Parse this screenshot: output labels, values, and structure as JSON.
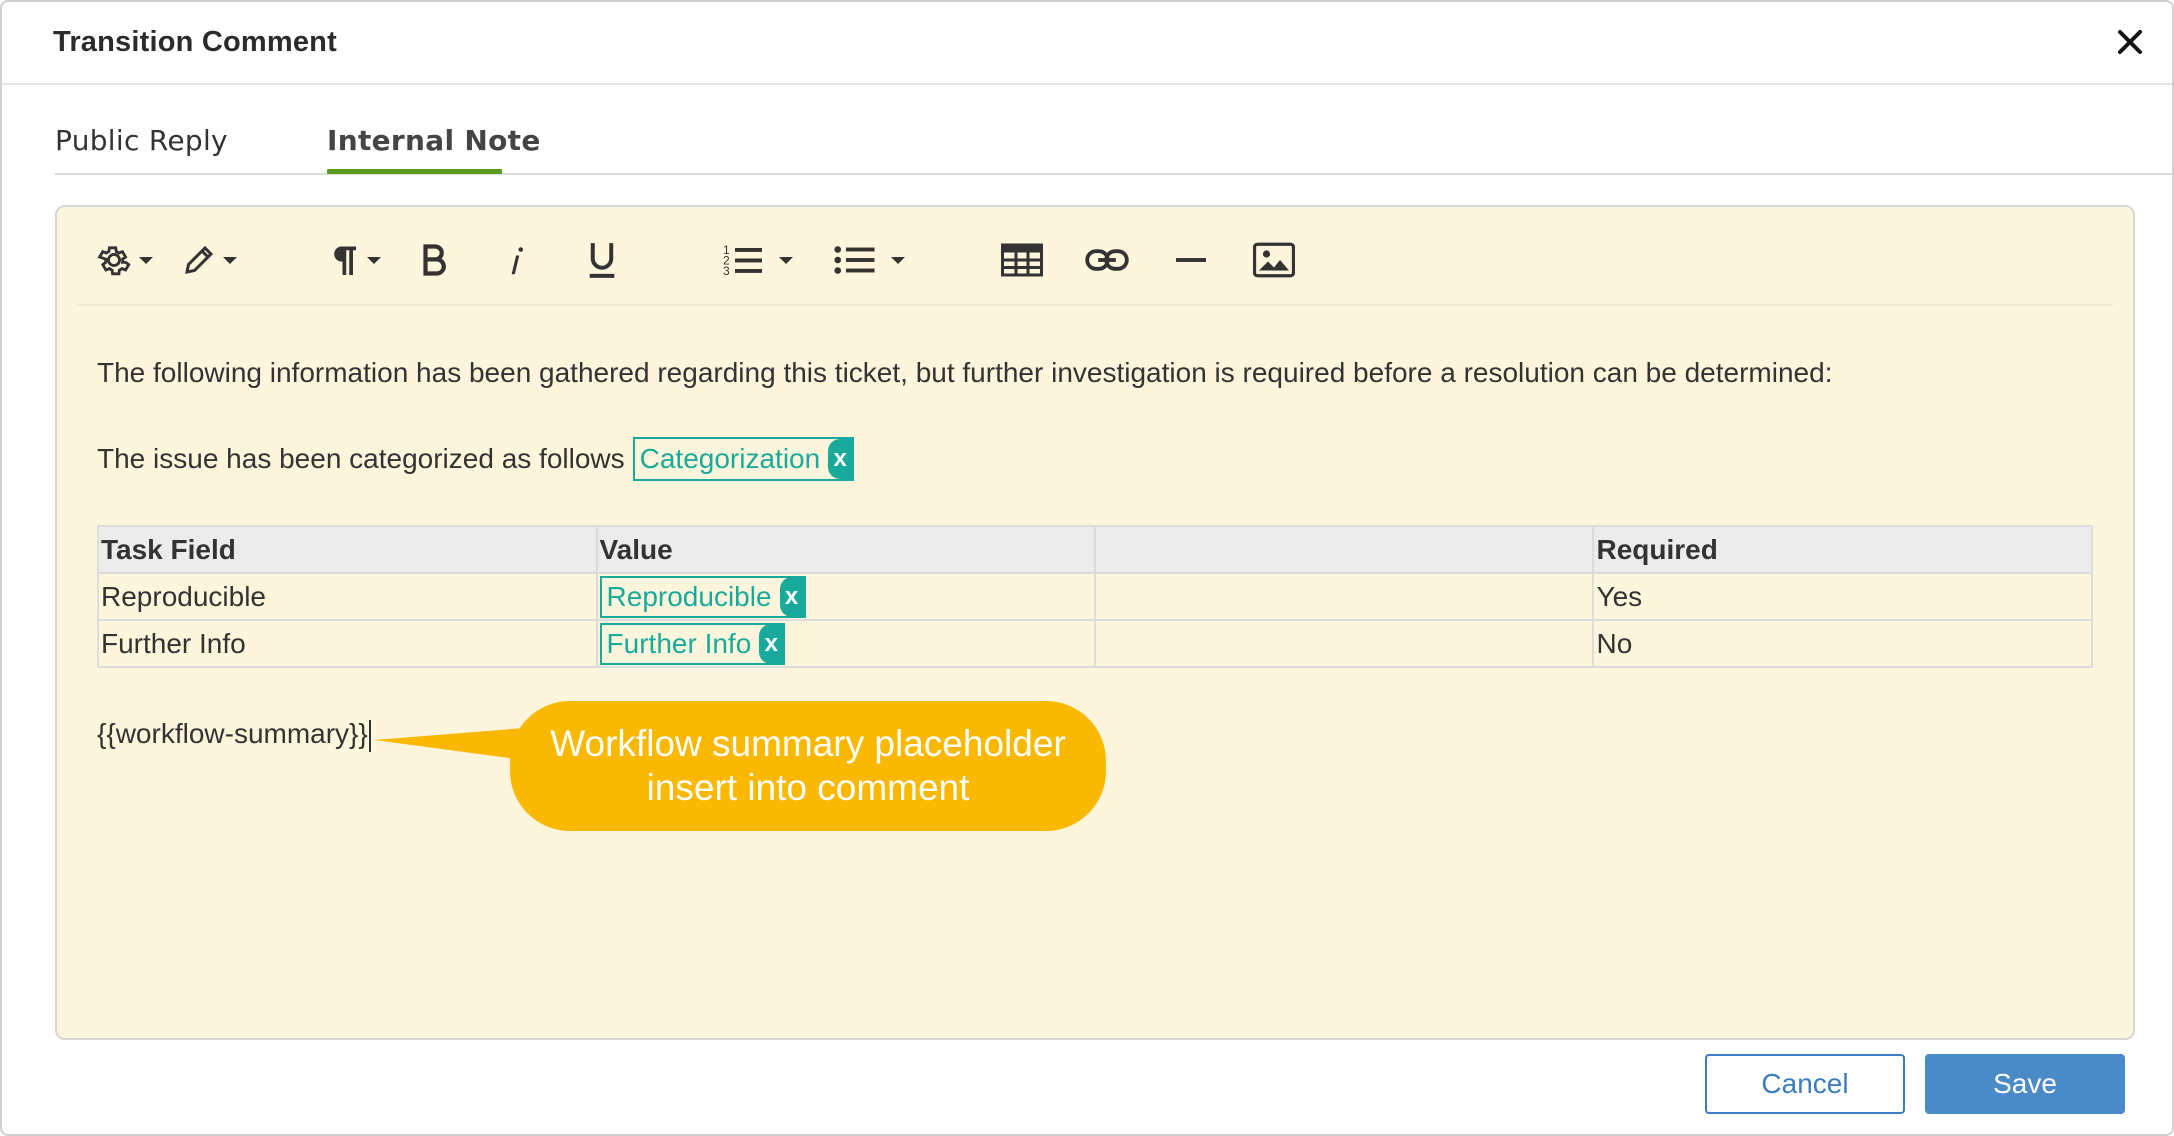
{
  "dialog": {
    "title": "Transition Comment",
    "close_icon": "close-icon"
  },
  "tabs": [
    {
      "label": "Public Reply",
      "active": false
    },
    {
      "label": "Internal Note",
      "active": true
    }
  ],
  "toolbar": {
    "items": [
      "gear-icon",
      "pencil-icon",
      "paragraph-icon",
      "bold-icon",
      "italic-icon",
      "underline-icon",
      "numbered-list-icon",
      "bullet-list-icon",
      "table-icon",
      "link-icon",
      "horizontal-rule-icon",
      "image-icon"
    ]
  },
  "editor": {
    "intro": "The following information has been gathered regarding this ticket, but further investigation is required before a resolution can be determined:",
    "category_prefix": "The issue has been categorized as follows",
    "category_token": "Categorization",
    "token_remove": "x",
    "table": {
      "headers": [
        "Task Field",
        "Value",
        "",
        "Required"
      ],
      "rows": [
        {
          "field": "Reproducible",
          "token": "Reproducible",
          "required": "Yes"
        },
        {
          "field": "Further Info",
          "token": "Further Info",
          "required": "No"
        }
      ]
    },
    "placeholder": "{{workflow-summary}}"
  },
  "callout": {
    "line1": "Workflow summary placeholder",
    "line2": "insert into comment",
    "color": "#fbb800"
  },
  "footer": {
    "cancel_label": "Cancel",
    "save_label": "Save"
  },
  "colors": {
    "accent_tab": "#5a9a1e",
    "token": "#1aaa9c",
    "editor_bg": "#fdf5dc",
    "primary_button": "#4a8ac7"
  }
}
